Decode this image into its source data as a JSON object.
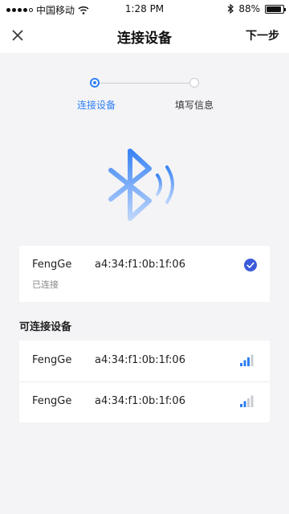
{
  "status_bar": {
    "carrier": "中国移动",
    "time": "1:28 PM",
    "battery": "88%",
    "battery_level": 0.88
  },
  "nav": {
    "title": "连接设备",
    "next_label": "下一步",
    "close_icon": "close-icon"
  },
  "steps": [
    {
      "label": "连接设备",
      "active": true
    },
    {
      "label": "填写信息",
      "active": false
    }
  ],
  "connected_device": {
    "name": "FengGe",
    "mac": "a4:34:f1:0b:1f:06",
    "status": "已连接",
    "icon": "check-circle-icon"
  },
  "available_section": {
    "title": "可连接设备",
    "devices": [
      {
        "name": "FengGe",
        "mac": "a4:34:f1:0b:1f:06",
        "signal_bars": 3,
        "signal_max": 4
      },
      {
        "name": "FengGe",
        "mac": "a4:34:f1:0b:1f:06",
        "signal_bars": 2,
        "signal_max": 4
      }
    ]
  },
  "colors": {
    "accent": "#2f7ff5",
    "check": "#3b5bdb",
    "signal_on": "#2f7ff5",
    "signal_off": "#c9ccd2"
  }
}
